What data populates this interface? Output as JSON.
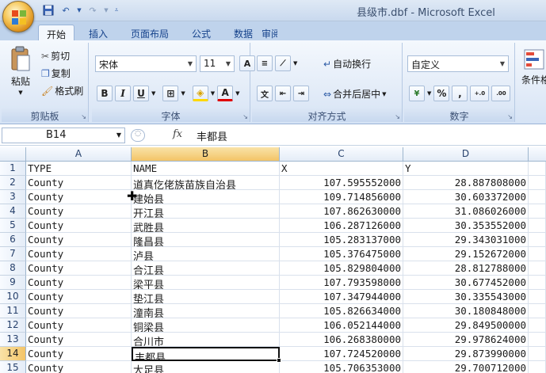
{
  "window": {
    "title": "县级市.dbf - Microsoft Excel"
  },
  "tabs": [
    {
      "label": "开始",
      "active": true
    },
    {
      "label": "插入",
      "active": false
    },
    {
      "label": "页面布局",
      "active": false
    },
    {
      "label": "公式",
      "active": false
    },
    {
      "label": "数据",
      "active": false
    },
    {
      "label": "审阅",
      "active": false
    }
  ],
  "ribbon": {
    "clipboard": {
      "label": "剪贴板",
      "paste": "粘贴",
      "cut": "剪切",
      "copy": "复制",
      "format_painter": "格式刷"
    },
    "font": {
      "label": "字体",
      "name": "宋体",
      "size": "11",
      "bold": "B",
      "italic": "I",
      "underline": "U"
    },
    "alignment": {
      "label": "对齐方式",
      "wrap": "自动换行",
      "merge": "合并后居中"
    },
    "number": {
      "label": "数字",
      "format": "自定义",
      "percent": "%",
      "comma": ",",
      "inc_decimal": "+.0\n.00",
      "dec_decimal": ".00\n+.0"
    },
    "styles": {
      "label": "条件格"
    }
  },
  "formula_bar": {
    "name_box": "B14",
    "fx": "fx",
    "content": "丰都县"
  },
  "columns": [
    "A",
    "B",
    "C",
    "D"
  ],
  "selected_column": "B",
  "selected_row": 14,
  "rows": [
    {
      "n": "1",
      "a": "TYPE",
      "b": "NAME",
      "c": "X",
      "d": "Y"
    },
    {
      "n": "2",
      "a": "County",
      "b": "道真仡佬族苗族自治县",
      "c": "107.595552000",
      "d": "28.887808000"
    },
    {
      "n": "3",
      "a": "County",
      "b": "建始县",
      "c": "109.714856000",
      "d": "30.603372000"
    },
    {
      "n": "4",
      "a": "County",
      "b": "开江县",
      "c": "107.862630000",
      "d": "31.086026000"
    },
    {
      "n": "5",
      "a": "County",
      "b": "武胜县",
      "c": "106.287126000",
      "d": "30.353552000"
    },
    {
      "n": "6",
      "a": "County",
      "b": "隆昌县",
      "c": "105.283137000",
      "d": "29.343031000"
    },
    {
      "n": "7",
      "a": "County",
      "b": "泸县",
      "c": "105.376475000",
      "d": "29.152672000"
    },
    {
      "n": "8",
      "a": "County",
      "b": "合江县",
      "c": "105.829804000",
      "d": "28.812788000"
    },
    {
      "n": "9",
      "a": "County",
      "b": "梁平县",
      "c": "107.793598000",
      "d": "30.677452000"
    },
    {
      "n": "10",
      "a": "County",
      "b": "垫江县",
      "c": "107.347944000",
      "d": "30.335543000"
    },
    {
      "n": "11",
      "a": "County",
      "b": "潼南县",
      "c": "105.826634000",
      "d": "30.180848000"
    },
    {
      "n": "12",
      "a": "County",
      "b": "铜梁县",
      "c": "106.052144000",
      "d": "29.849500000"
    },
    {
      "n": "13",
      "a": "County",
      "b": "合川市",
      "c": "106.268380000",
      "d": "29.978624000"
    },
    {
      "n": "14",
      "a": "County",
      "b": "丰都县",
      "c": "107.724520000",
      "d": "29.873990000"
    },
    {
      "n": "15",
      "a": "County",
      "b": "大足县",
      "c": "105.706353000",
      "d": "29.700712000"
    }
  ],
  "colors": {
    "accent": "#15428b",
    "selected_header": "#f3c467"
  }
}
